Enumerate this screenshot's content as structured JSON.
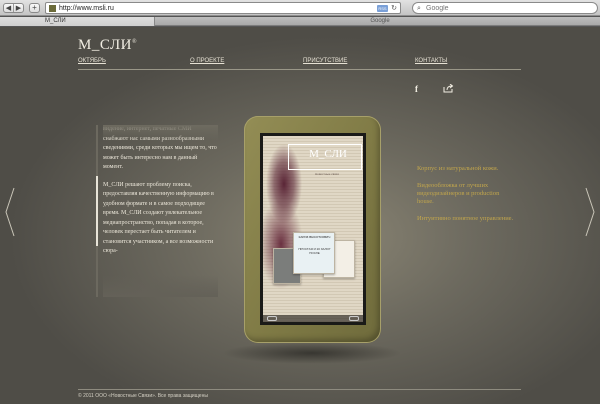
{
  "browser": {
    "url": "http://www.msli.ru",
    "search_placeholder": "Google",
    "tab_title": "М_СЛИ",
    "other_tab_title": "Google",
    "back_glyph": "◀",
    "forward_glyph": "▶",
    "add_glyph": "+",
    "rss_label": "RSS",
    "reload_glyph": "↻",
    "search_glyph": "⌕"
  },
  "site": {
    "logo": "М_СЛИ",
    "logo_mark": "®",
    "nav": [
      {
        "label": "ОКТЯБРЬ"
      },
      {
        "label": "О ПРОЕКТЕ"
      },
      {
        "label": "ПРИСУТСТВИЕ"
      },
      {
        "label": "КОНТАКТЫ"
      }
    ],
    "social": {
      "facebook_glyph": "f"
    },
    "body": [
      "видение, интернет, печатные СМИ снабжают нас самыми разнообразными сведениями, среди которых мы ищем то, что может быть интересно нам в данный момент.",
      "М_СЛИ решают проблему поиска, предоставляя качественную информацию в удобном формате и в самое подходящее время. М_СЛИ создают увлекательное медиапространство, попадая в которое, человек перестает быть читателем и становится участником, а все возможности сюра-"
    ],
    "screen": {
      "logo": "М_СЛИ",
      "subtitle": "Новостные связи",
      "card_label": "КАРИЗ ВЫСОТКОВИЧ",
      "card_text": "ПРОСТАЯ И 20 ЗАЛОГ ПОСЛЕ"
    },
    "features": [
      "Корпус из натуральной кожи.",
      "Видеообложка от лучших видеодизайнеров и production house.",
      "Интуитивно понятное управление."
    ],
    "footer": "© 2011 ООО «Новостные Связи». Все права защищены"
  },
  "colors": {
    "accent_gold": "#c2a64c",
    "device_olive": "#857f49",
    "text_cream": "#ece7da"
  }
}
